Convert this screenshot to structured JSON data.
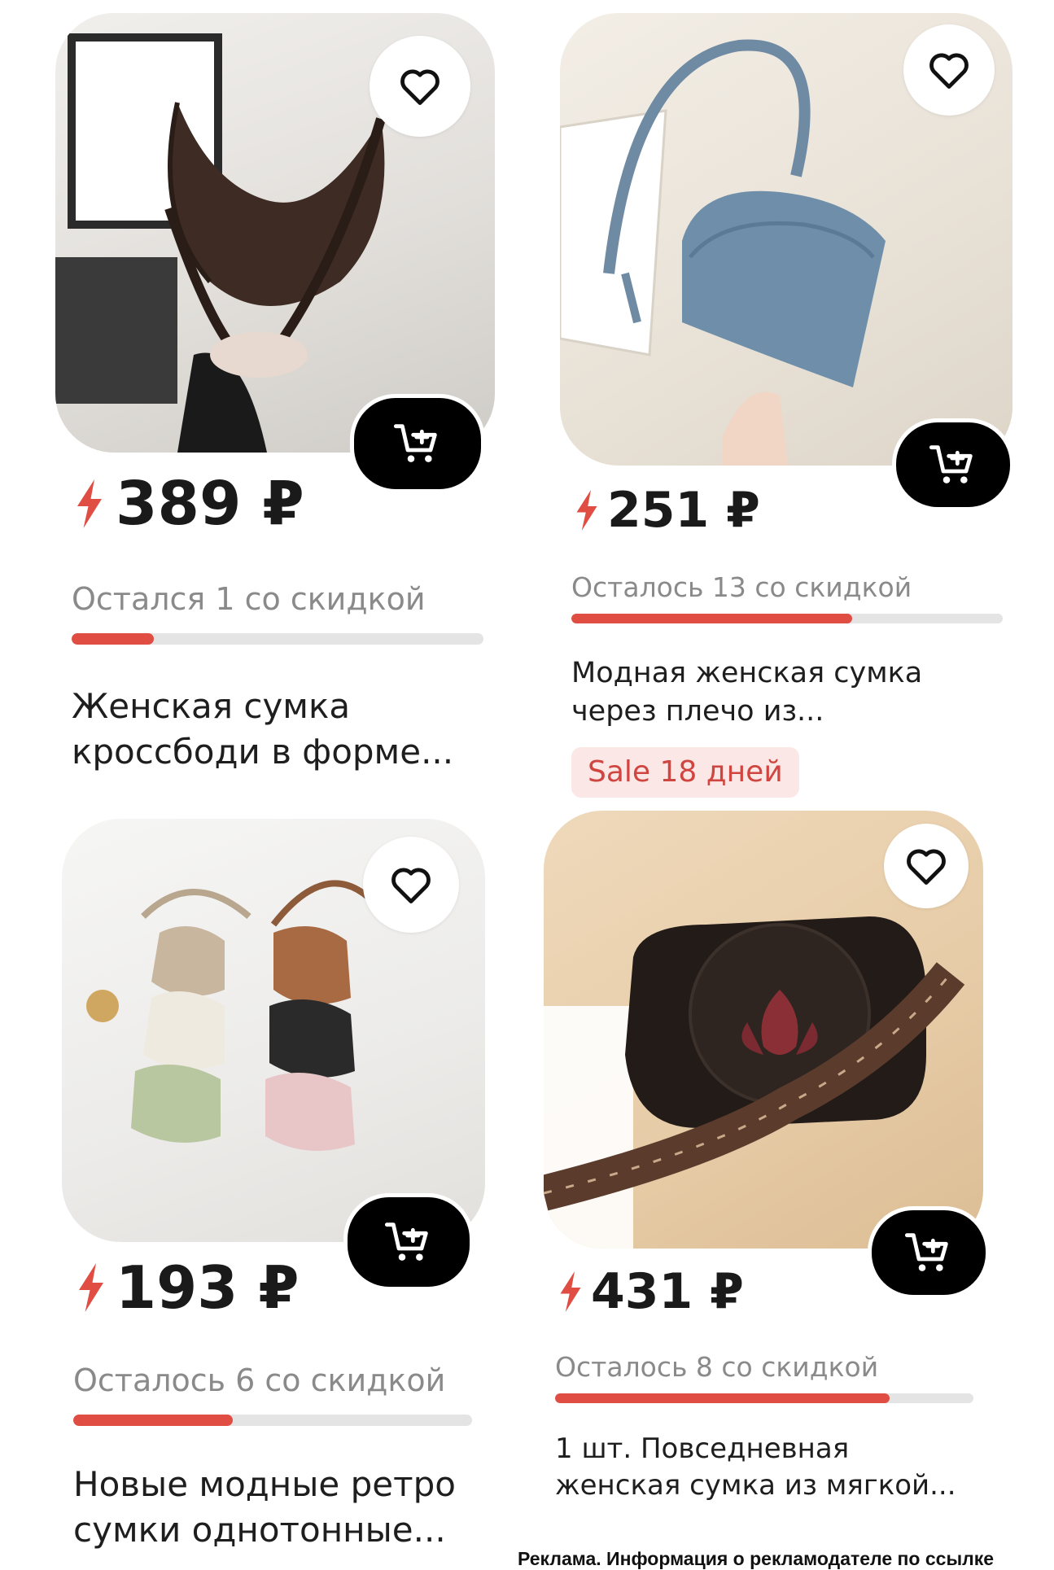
{
  "products": [
    {
      "price": "389 ₽",
      "remaining": "Остался 1 со скидкой",
      "progress": 0.2,
      "title_line1": "Женская сумка",
      "title_line2": "кроссбоди в форме..."
    },
    {
      "price": "251 ₽",
      "remaining": "Осталось 13 со скидкой",
      "progress": 0.65,
      "title_line1": "Модная женская сумка",
      "title_line2": "через плечо из...",
      "badge": "Sale 18 дней"
    },
    {
      "price": "193 ₽",
      "remaining": "Осталось 6 со скидкой",
      "progress": 0.4,
      "title_line1": "Новые модные ретро",
      "title_line2": "сумки однотонные..."
    },
    {
      "price": "431 ₽",
      "remaining": "Осталось 8 со скидкой",
      "progress": 0.8,
      "title_line1": "1 шт. Повседневная",
      "title_line2": "женская сумка из мягкой..."
    }
  ],
  "ad_notice": "Реклама. Информация о рекламодателе по ссылке",
  "colors": {
    "accent": "#df4d43",
    "sale_badge_bg": "#fbe7e6",
    "sale_badge_text": "#d0453f",
    "progress_track": "#e4e4e4",
    "muted_text": "#8a8a8a"
  },
  "icons": {
    "favorite": "heart-outline-icon",
    "cart": "cart-plus-icon",
    "price_marker": "lightning-bolt-icon"
  }
}
